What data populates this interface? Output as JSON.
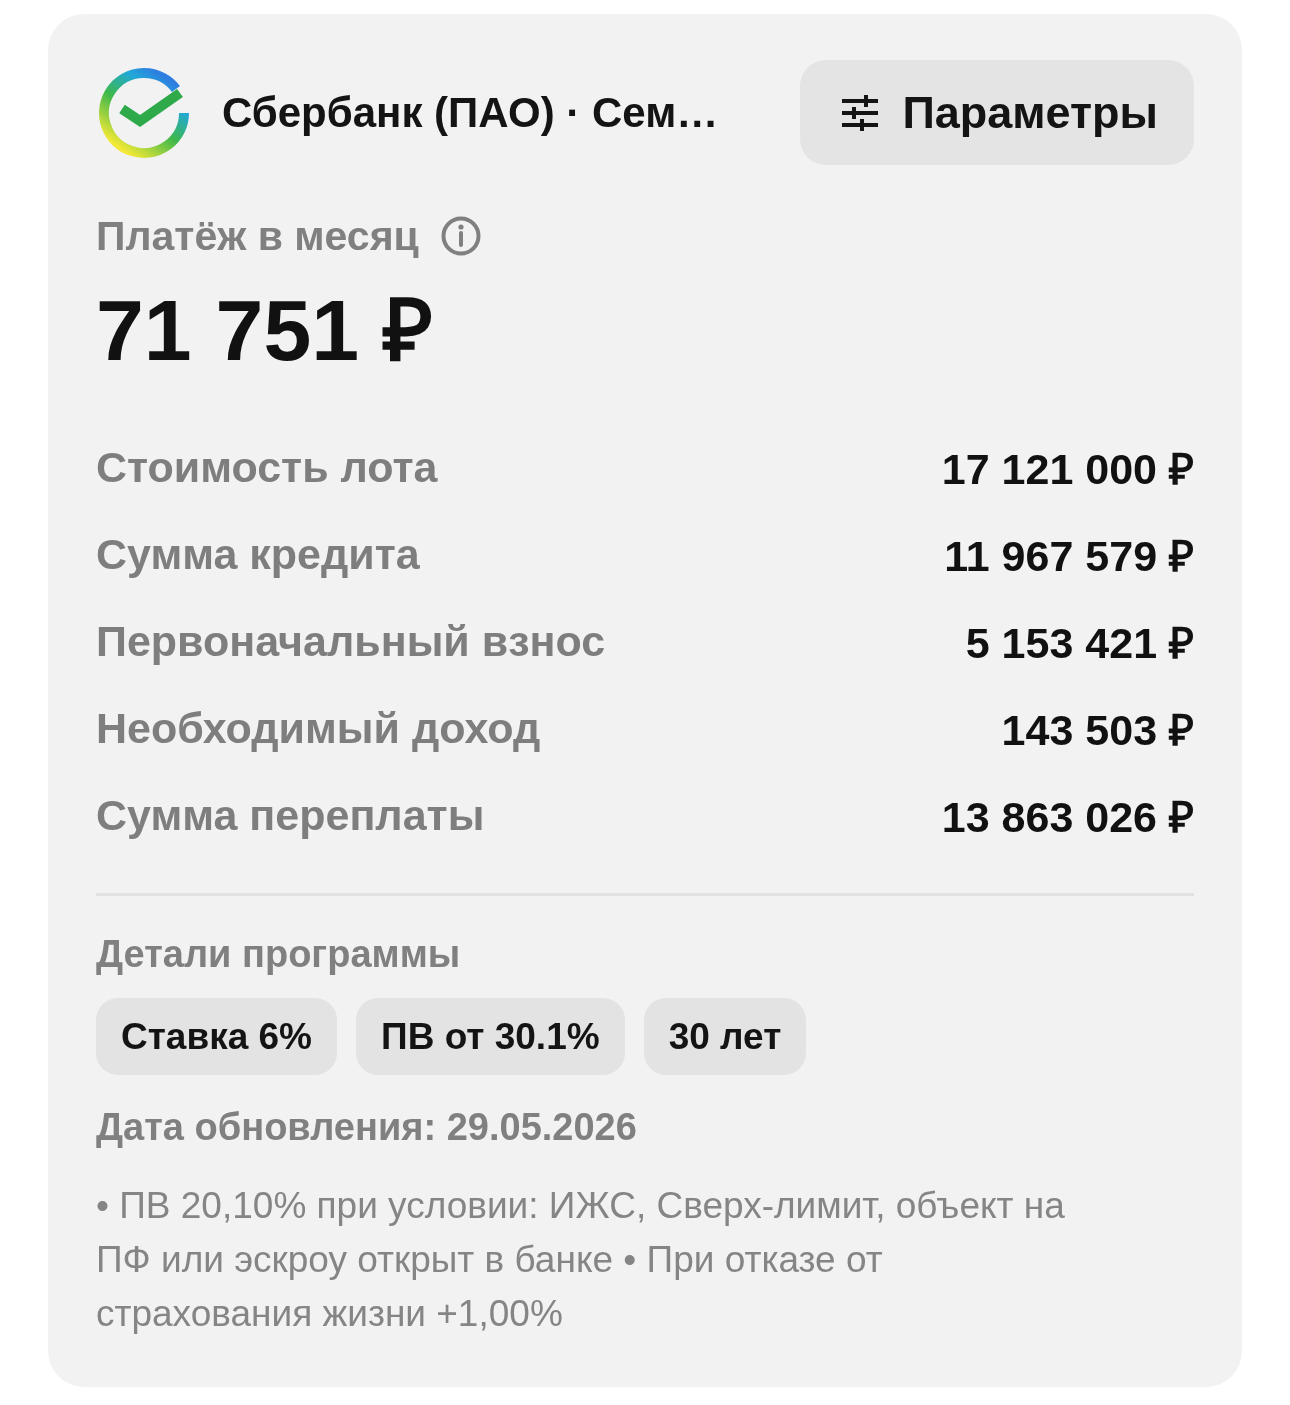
{
  "header": {
    "bank_title": "Сбербанк (ПАО) · Сем…",
    "params_button": "Параметры"
  },
  "payment": {
    "label": "Платёж в месяц",
    "amount": "71 751 ₽"
  },
  "summary_rows": [
    {
      "label": "Стоимость лота",
      "value": "17 121 000 ₽"
    },
    {
      "label": "Сумма кредита",
      "value": "11 967 579 ₽"
    },
    {
      "label": "Первоначальный взнос",
      "value": "5 153 421 ₽"
    },
    {
      "label": "Необходимый доход",
      "value": "143 503 ₽"
    },
    {
      "label": "Сумма переплаты",
      "value": "13 863 026 ₽"
    }
  ],
  "program": {
    "heading": "Детали программы",
    "chips": [
      "Ставка 6%",
      "ПВ от 30.1%",
      "30 лет"
    ],
    "updated": "Дата обновления: 29.05.2026",
    "note": "• ПВ 20,10% при условии: ИЖС, Сверх-лимит, объект на ПФ или эскроу открыт в банке • При отказе от страхования жизни +1,00%"
  }
}
